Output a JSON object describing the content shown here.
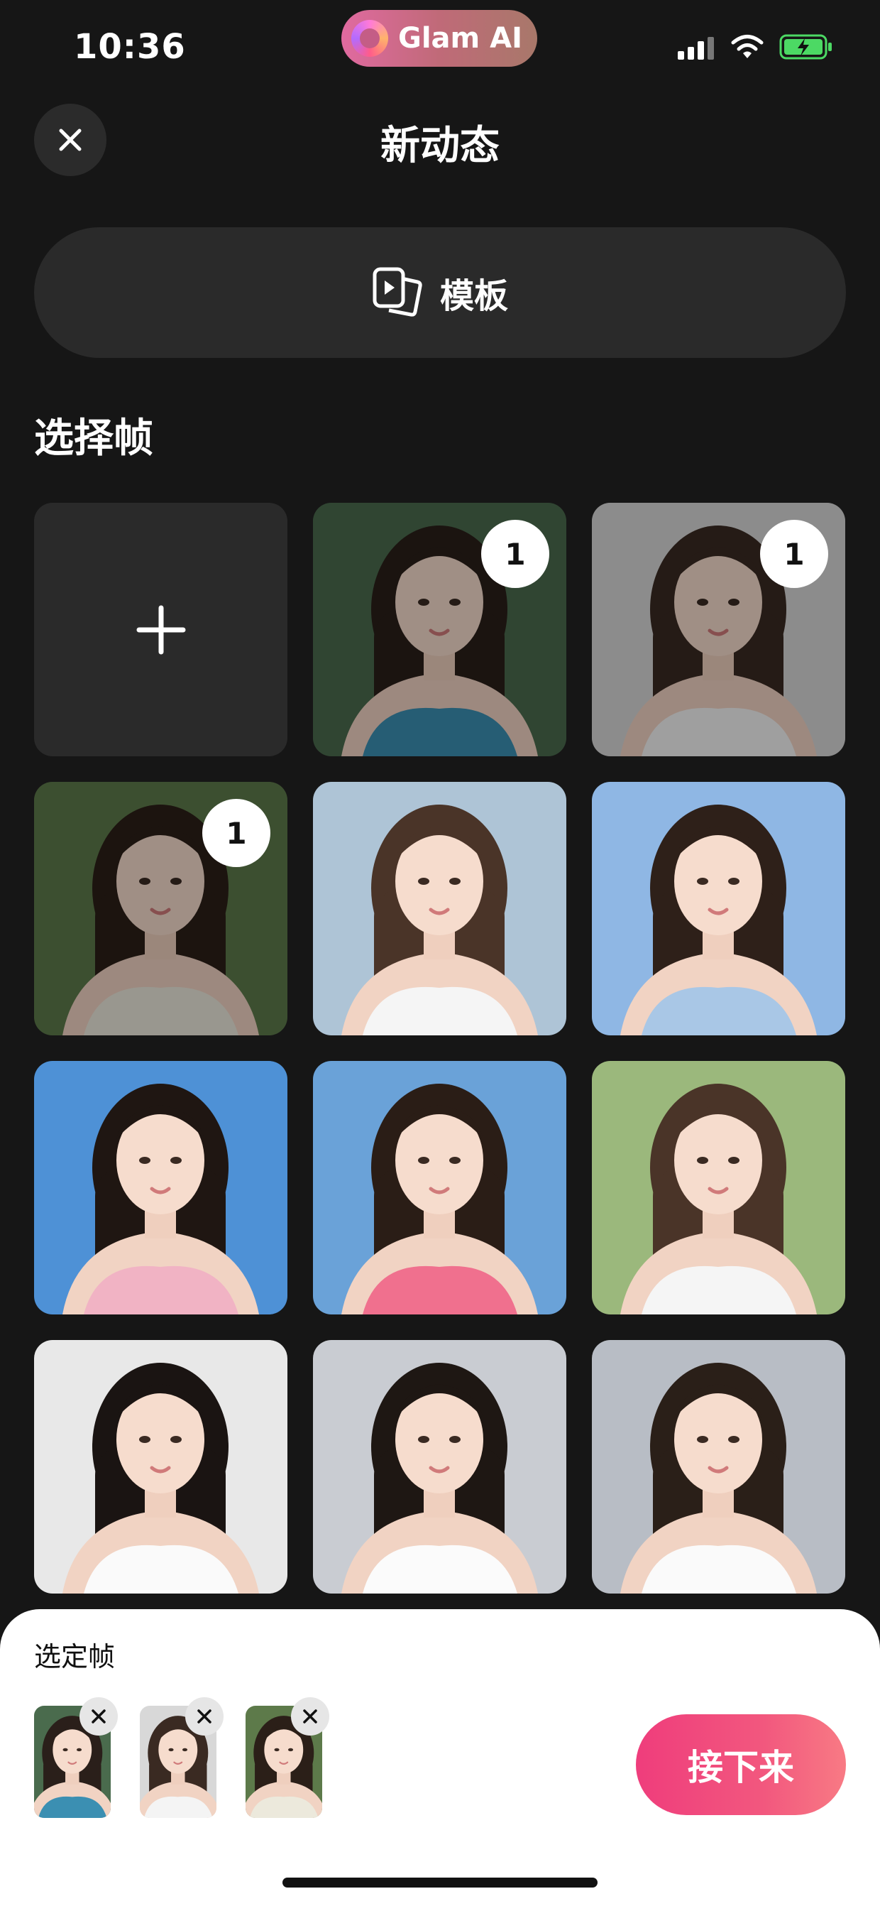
{
  "status_bar": {
    "time": "10:36",
    "app_pill": "Glam AI"
  },
  "header": {
    "title": "新动态",
    "close_icon": "close-icon"
  },
  "template_button": {
    "label": "模板",
    "icon": "template-video-icon"
  },
  "section": {
    "title": "选择帧"
  },
  "grid": {
    "add_icon": "plus-icon",
    "tiles": [
      {
        "kind": "add"
      },
      {
        "kind": "photo",
        "selected": true,
        "badge": "1",
        "bg": "#4a6b4d",
        "hair": "#2a1f1a",
        "top": "#3b8fb2"
      },
      {
        "kind": "photo",
        "selected": true,
        "badge": "1",
        "bg": "#d8d8d8",
        "hair": "#3a2a22",
        "top": "#f4f4f4"
      },
      {
        "kind": "photo",
        "selected": true,
        "badge": "1",
        "bg": "#5d7a4a",
        "hair": "#2b1f18",
        "top": "#ece9dc"
      },
      {
        "kind": "photo",
        "selected": false,
        "bg": "#aec4d6",
        "hair": "#4a3428",
        "top": "#f5f5f5"
      },
      {
        "kind": "photo",
        "selected": false,
        "bg": "#8fb7e4",
        "hair": "#2e2019",
        "top": "#a9c7e6"
      },
      {
        "kind": "photo",
        "selected": false,
        "bg": "#4e91d6",
        "hair": "#1f1612",
        "top": "#f1b3c4"
      },
      {
        "kind": "photo",
        "selected": false,
        "bg": "#6aa2d8",
        "hair": "#2a1d16",
        "top": "#f0708e"
      },
      {
        "kind": "photo",
        "selected": false,
        "bg": "#9bb87c",
        "hair": "#4a3428",
        "top": "#f5f5f5"
      },
      {
        "kind": "photo",
        "selected": false,
        "bg": "#e8e8e8",
        "hair": "#1a1412",
        "top": "#fafafa"
      },
      {
        "kind": "photo",
        "selected": false,
        "bg": "#c9ccd2",
        "hair": "#1e1713",
        "top": "#fbfbfb"
      },
      {
        "kind": "photo",
        "selected": false,
        "bg": "#b8bdc5",
        "hair": "#2a1f18",
        "top": "#fafafa"
      }
    ]
  },
  "selected_sheet": {
    "title": "选定帧",
    "remove_icon": "close-icon",
    "next_label": "接下来"
  },
  "colors": {
    "background": "#161616",
    "surface": "#2a2a2a",
    "accent": "#ef3d7c"
  }
}
